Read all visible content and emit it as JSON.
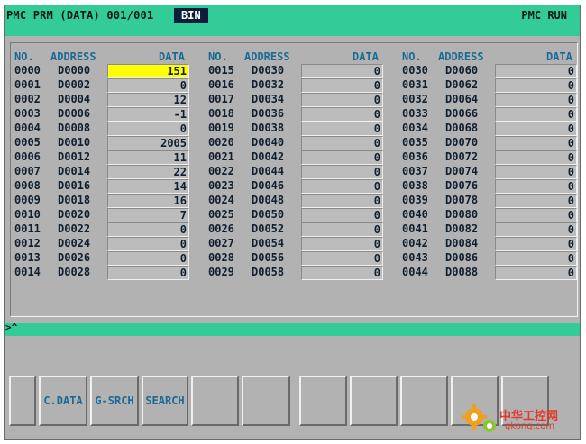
{
  "header": {
    "title": "PMC PRM (DATA) 001/001",
    "mode": "BIN",
    "status": "PMC RUN"
  },
  "table": {
    "columns": {
      "no": "NO.",
      "address": "ADDRESS",
      "data": "DATA"
    },
    "selected": {
      "group": 0,
      "row": 0
    },
    "groups": [
      {
        "rows": [
          {
            "no": "0000",
            "address": "D0000",
            "data": "151"
          },
          {
            "no": "0001",
            "address": "D0002",
            "data": "0"
          },
          {
            "no": "0002",
            "address": "D0004",
            "data": "12"
          },
          {
            "no": "0003",
            "address": "D0006",
            "data": "-1"
          },
          {
            "no": "0004",
            "address": "D0008",
            "data": "0"
          },
          {
            "no": "0005",
            "address": "D0010",
            "data": "2005"
          },
          {
            "no": "0006",
            "address": "D0012",
            "data": "11"
          },
          {
            "no": "0007",
            "address": "D0014",
            "data": "22"
          },
          {
            "no": "0008",
            "address": "D0016",
            "data": "14"
          },
          {
            "no": "0009",
            "address": "D0018",
            "data": "16"
          },
          {
            "no": "0010",
            "address": "D0020",
            "data": "7"
          },
          {
            "no": "0011",
            "address": "D0022",
            "data": "0"
          },
          {
            "no": "0012",
            "address": "D0024",
            "data": "0"
          },
          {
            "no": "0013",
            "address": "D0026",
            "data": "0"
          },
          {
            "no": "0014",
            "address": "D0028",
            "data": "0"
          }
        ]
      },
      {
        "rows": [
          {
            "no": "0015",
            "address": "D0030",
            "data": "0"
          },
          {
            "no": "0016",
            "address": "D0032",
            "data": "0"
          },
          {
            "no": "0017",
            "address": "D0034",
            "data": "0"
          },
          {
            "no": "0018",
            "address": "D0036",
            "data": "0"
          },
          {
            "no": "0019",
            "address": "D0038",
            "data": "0"
          },
          {
            "no": "0020",
            "address": "D0040",
            "data": "0"
          },
          {
            "no": "0021",
            "address": "D0042",
            "data": "0"
          },
          {
            "no": "0022",
            "address": "D0044",
            "data": "0"
          },
          {
            "no": "0023",
            "address": "D0046",
            "data": "0"
          },
          {
            "no": "0024",
            "address": "D0048",
            "data": "0"
          },
          {
            "no": "0025",
            "address": "D0050",
            "data": "0"
          },
          {
            "no": "0026",
            "address": "D0052",
            "data": "0"
          },
          {
            "no": "0027",
            "address": "D0054",
            "data": "0"
          },
          {
            "no": "0028",
            "address": "D0056",
            "data": "0"
          },
          {
            "no": "0029",
            "address": "D0058",
            "data": "0"
          }
        ]
      },
      {
        "rows": [
          {
            "no": "0030",
            "address": "D0060",
            "data": "0"
          },
          {
            "no": "0031",
            "address": "D0062",
            "data": "0"
          },
          {
            "no": "0032",
            "address": "D0064",
            "data": "0"
          },
          {
            "no": "0033",
            "address": "D0066",
            "data": "0"
          },
          {
            "no": "0034",
            "address": "D0068",
            "data": "0"
          },
          {
            "no": "0035",
            "address": "D0070",
            "data": "0"
          },
          {
            "no": "0036",
            "address": "D0072",
            "data": "0"
          },
          {
            "no": "0037",
            "address": "D0074",
            "data": "0"
          },
          {
            "no": "0038",
            "address": "D0076",
            "data": "0"
          },
          {
            "no": "0039",
            "address": "D0078",
            "data": "0"
          },
          {
            "no": "0040",
            "address": "D0080",
            "data": "0"
          },
          {
            "no": "0041",
            "address": "D0082",
            "data": "0"
          },
          {
            "no": "0042",
            "address": "D0084",
            "data": "0"
          },
          {
            "no": "0043",
            "address": "D0086",
            "data": "0"
          },
          {
            "no": "0044",
            "address": "D0088",
            "data": "0"
          }
        ]
      }
    ]
  },
  "command": {
    "prompt": ">^"
  },
  "softkeys": [
    "",
    "C.DATA",
    "G-SRCH",
    "SEARCH",
    "",
    "",
    "",
    "",
    "",
    "",
    ""
  ],
  "watermark": {
    "name": "中华工控网",
    "url": "gkong.com"
  },
  "colors": {
    "accent": "#33cc99",
    "background": "#b2b2b2",
    "selected": "#ffff00",
    "label": "#1b6a96"
  }
}
